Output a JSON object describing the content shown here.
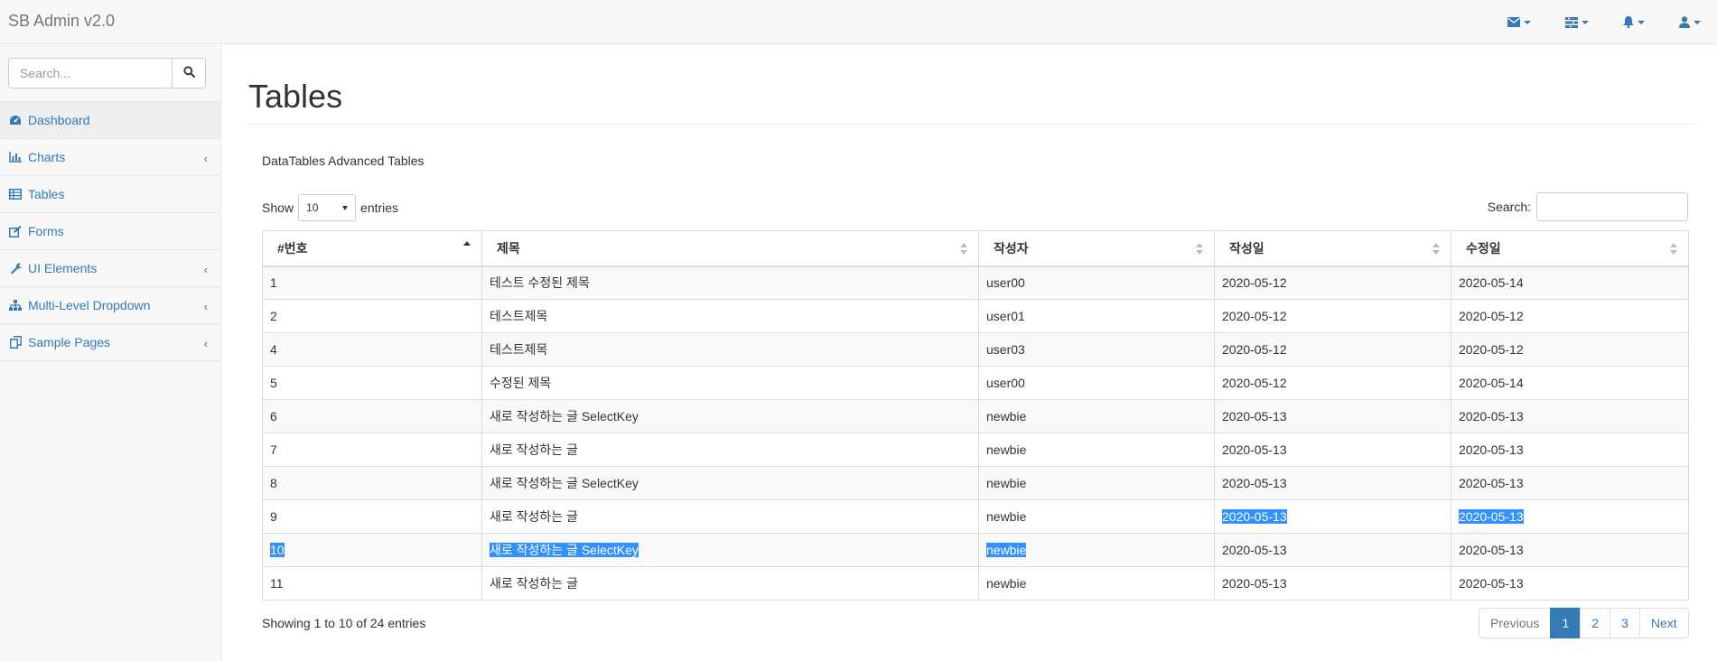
{
  "navbar": {
    "brand": "SB Admin v2.0",
    "icons": [
      "envelope-icon",
      "tasks-icon",
      "bell-icon",
      "user-icon"
    ],
    "accent_color": "#337ab7"
  },
  "sidebar": {
    "search_placeholder": "Search...",
    "items": [
      {
        "label": "Dashboard",
        "icon": "dashboard-icon",
        "active": true,
        "has_submenu": false
      },
      {
        "label": "Charts",
        "icon": "bar-chart-icon",
        "active": false,
        "has_submenu": true
      },
      {
        "label": "Tables",
        "icon": "table-icon",
        "active": false,
        "has_submenu": false
      },
      {
        "label": "Forms",
        "icon": "edit-icon",
        "active": false,
        "has_submenu": false
      },
      {
        "label": "UI Elements",
        "icon": "wrench-icon",
        "active": false,
        "has_submenu": true
      },
      {
        "label": "Multi-Level Dropdown",
        "icon": "sitemap-icon",
        "active": false,
        "has_submenu": true
      },
      {
        "label": "Sample Pages",
        "icon": "files-icon",
        "active": false,
        "has_submenu": true
      }
    ],
    "submenu_chevron": "‹"
  },
  "main": {
    "title": "Tables",
    "panel_heading": "DataTables Advanced Tables",
    "length": {
      "prefix": "Show",
      "value": "10",
      "suffix": "entries"
    },
    "filter_label": "Search:",
    "columns": [
      "#번호",
      "제목",
      "작성자",
      "작성일",
      "수정일"
    ],
    "rows": [
      [
        "1",
        "테스트 수정된 제목",
        "user00",
        "2020-05-12",
        "2020-05-14"
      ],
      [
        "2",
        "테스트제목",
        "user01",
        "2020-05-12",
        "2020-05-12"
      ],
      [
        "4",
        "테스트제목",
        "user03",
        "2020-05-12",
        "2020-05-12"
      ],
      [
        "5",
        "수정된 제목",
        "user00",
        "2020-05-12",
        "2020-05-14"
      ],
      [
        "6",
        "새로 작성하는 글 SelectKey",
        "newbie",
        "2020-05-13",
        "2020-05-13"
      ],
      [
        "7",
        "새로 작성하는 글",
        "newbie",
        "2020-05-13",
        "2020-05-13"
      ],
      [
        "8",
        "새로 작성하는 글 SelectKey",
        "newbie",
        "2020-05-13",
        "2020-05-13"
      ],
      [
        "9",
        "새로 작성하는 글",
        "newbie",
        "2020-05-13",
        "2020-05-13"
      ],
      [
        "10",
        "새로 작성하는 글 SelectKey",
        "newbie",
        "2020-05-13",
        "2020-05-13"
      ],
      [
        "11",
        "새로 작성하는 글",
        "newbie",
        "2020-05-13",
        "2020-05-13"
      ]
    ],
    "text_selection": [
      [
        7,
        3
      ],
      [
        7,
        4
      ],
      [
        8,
        0
      ],
      [
        8,
        1
      ],
      [
        8,
        2
      ]
    ],
    "selection_color": "#3390ff",
    "info": "Showing 1 to 10 of 24 entries",
    "pagination": {
      "previous": "Previous",
      "pages": [
        "1",
        "2",
        "3"
      ],
      "current": "1",
      "next": "Next"
    }
  }
}
